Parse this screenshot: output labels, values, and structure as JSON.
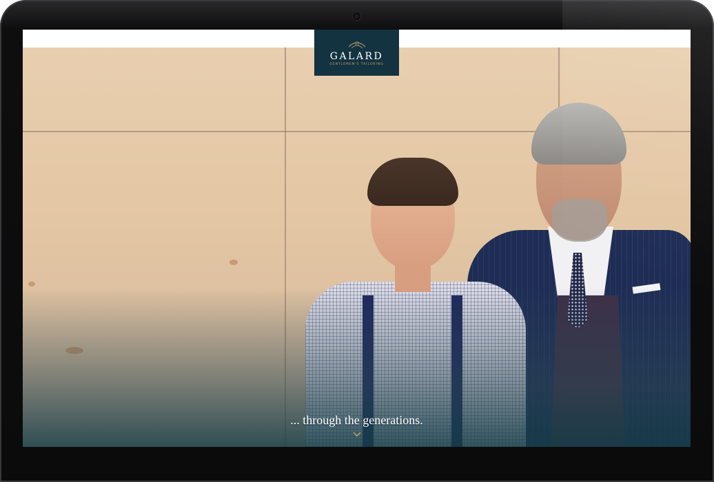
{
  "brand": {
    "name": "GALARD",
    "subtitle": "Gentlemen's Tailoring",
    "color": "#143341",
    "accent": "#c8a86a"
  },
  "hero": {
    "tagline": "... through the generations.",
    "scroll_icon": "chevron-down-icon"
  }
}
